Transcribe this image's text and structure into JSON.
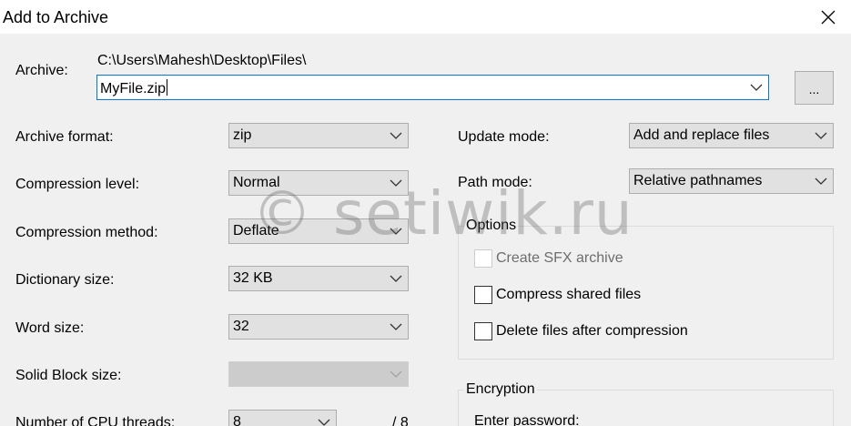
{
  "window": {
    "title": "Add to Archive"
  },
  "archive": {
    "label": "Archive:",
    "folder_path": "C:\\Users\\Mahesh\\Desktop\\Files\\",
    "file_name": "MyFile.zip",
    "browse_label": "..."
  },
  "left": {
    "format_label": "Archive format:",
    "format_value": "zip",
    "level_label": "Compression level:",
    "level_value": "Normal",
    "method_label": "Compression method:",
    "method_value": "Deflate",
    "dict_label": "Dictionary size:",
    "dict_value": "32 KB",
    "word_label": "Word size:",
    "word_value": "32",
    "solid_label": "Solid Block size:",
    "solid_value": "",
    "threads_label": "Number of CPU threads:",
    "threads_value": "8",
    "threads_max": "/ 8"
  },
  "right": {
    "update_label": "Update mode:",
    "update_value": "Add and replace files",
    "path_label": "Path mode:",
    "path_value": "Relative pathnames"
  },
  "options": {
    "title": "Options",
    "sfx_label": "Create SFX archive",
    "sfx_checked": false,
    "sfx_enabled": false,
    "shared_label": "Compress shared files",
    "shared_checked": false,
    "delete_label": "Delete files after compression",
    "delete_checked": false
  },
  "encryption": {
    "title": "Encryption",
    "password_label": "Enter password:"
  },
  "watermark": "© setiwik.ru",
  "icons": {
    "close": "close-icon",
    "dropdown": "chevron-down-icon"
  }
}
